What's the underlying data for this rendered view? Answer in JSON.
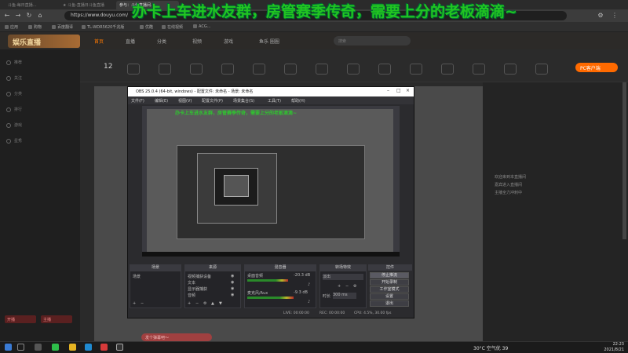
{
  "browser": {
    "tabs": [
      "斗鱼-每日直播...",
      "★ 斗鱼-直播日斗鱼直播",
      "参与：斗鱼直播间..."
    ],
    "url": "https://www.douyu.com/",
    "bookmarks": [
      "应用",
      "购物",
      "百度翻译",
      "TL-WDR5620千兆版",
      "优酷",
      "在线视频",
      "ACG..."
    ]
  },
  "overlay_title": "办卡上车进水友群，房管赛季传奇，需要上分的老板滴滴~",
  "site": {
    "logo": "娱乐直播",
    "nav": [
      "首页",
      "直播",
      "分类",
      "视频",
      "游戏",
      "鱼乐 圈圈"
    ],
    "search_placeholder": "搜索",
    "count": "12",
    "pc_button": "PC客户端",
    "sidebar_items": [
      "推荐",
      "关注",
      "分类",
      "排行",
      "游戏",
      "星秀"
    ],
    "sidebar_buttons": [
      "开播",
      "主播"
    ],
    "right_lines": [
      "欢迎来到本直播间",
      "嘉宾进入直播间",
      "主播全力冲刺中"
    ]
  },
  "obs": {
    "title": "OBS 25.0.4 (64-bit, windows) - 配置文件: 未命名 - 场景: 未命名",
    "menu": [
      "文件(F)",
      "编辑(E)",
      "视图(V)",
      "配置文件(P)",
      "场景集合(S)",
      "工具(T)",
      "帮助(H)"
    ],
    "preview_caption": "办卡上车进水友群，房管赛季传奇，需要上分的老板滴滴~",
    "docks": {
      "scenes": "场景",
      "sources": "来源",
      "mixer": "混音器",
      "transitions": "转场特效",
      "controls": "控件"
    },
    "scene_items": [
      "场景"
    ],
    "source_items": [
      "视频捕获设备",
      "文本",
      "显示器捕获",
      "音频"
    ],
    "mixer_channels": [
      {
        "name": "桌面音频",
        "db": "-20.3 dB",
        "level": 0.7
      },
      {
        "name": "麦克风/Aux",
        "db": "-9.3 dB",
        "level": 0.8
      }
    ],
    "transition": {
      "type": "淡出",
      "duration_label": "时长",
      "duration": "300 ms"
    },
    "controls": [
      "停止推流",
      "开始录制",
      "工作室模式",
      "设置",
      "退出"
    ],
    "status": {
      "live": "LIVE: 00:00:00",
      "rec": "REC: 00:00:00",
      "cpu": "CPU: 4.5%, 30.00 fps"
    }
  },
  "danmu": "发个弹幕吧～",
  "taskbar": {
    "temp": "30°C 空气优 39",
    "time": "22:23",
    "date": "2021/8/21"
  },
  "colors": {
    "accent": "#ff6a00",
    "overlay_green": "#21c521"
  }
}
